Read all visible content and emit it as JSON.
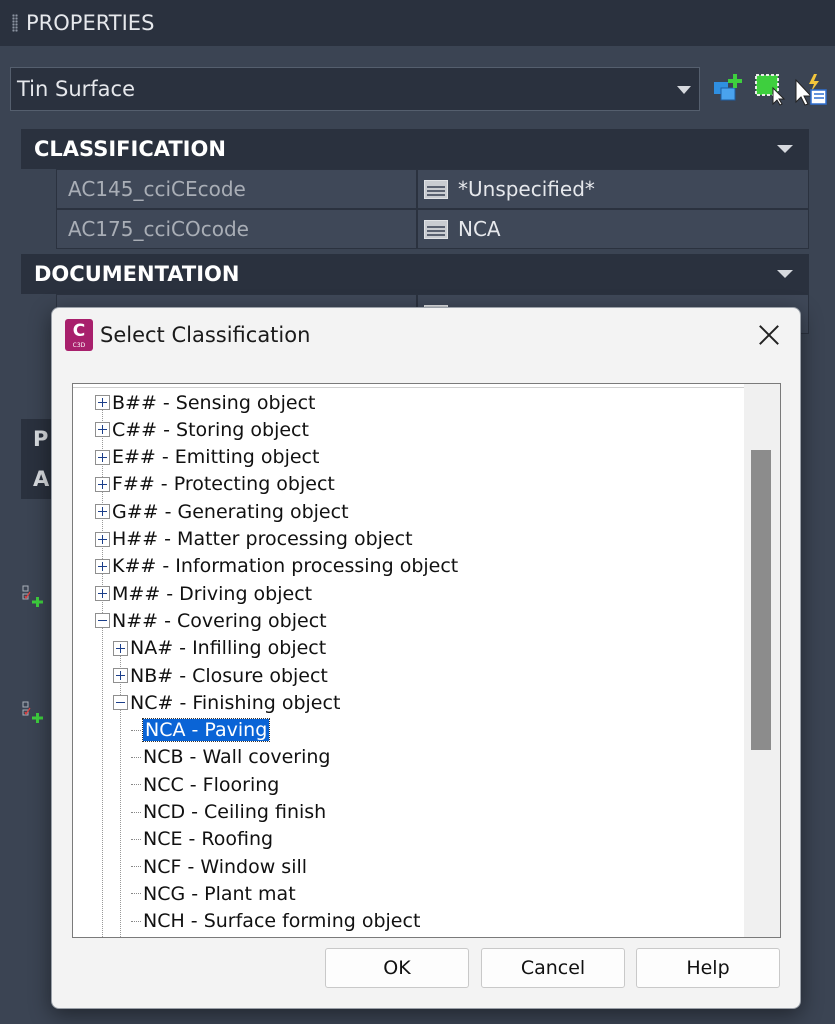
{
  "palette": {
    "title": "PROPERTIES",
    "object_type": "Tin Surface",
    "categories": [
      {
        "name": "CLASSIFICATION",
        "rows": [
          {
            "name": "AC145_cciCEcode",
            "value": "*Unspecified*"
          },
          {
            "name": "AC175_cciCOcode",
            "value": "NCA"
          }
        ]
      },
      {
        "name": "DOCUMENTATION"
      }
    ],
    "stub_1": "P",
    "stub_2": "A"
  },
  "dialog": {
    "title": "Select Classification",
    "app_icon_letter": "C",
    "app_icon_sub": "C3D",
    "tree": [
      {
        "label": "B## - Sensing object",
        "level": 0,
        "expander": "plus"
      },
      {
        "label": "C## - Storing object",
        "level": 0,
        "expander": "plus"
      },
      {
        "label": "E## - Emitting object",
        "level": 0,
        "expander": "plus"
      },
      {
        "label": "F## - Protecting object",
        "level": 0,
        "expander": "plus"
      },
      {
        "label": "G## - Generating object",
        "level": 0,
        "expander": "plus"
      },
      {
        "label": "H## - Matter processing object",
        "level": 0,
        "expander": "plus"
      },
      {
        "label": "K## - Information processing object",
        "level": 0,
        "expander": "plus"
      },
      {
        "label": "M## - Driving object",
        "level": 0,
        "expander": "plus"
      },
      {
        "label": "N## - Covering object",
        "level": 0,
        "expander": "minus"
      },
      {
        "label": "NA# - Infilling object",
        "level": 1,
        "expander": "plus"
      },
      {
        "label": "NB# - Closure object",
        "level": 1,
        "expander": "plus"
      },
      {
        "label": "NC# - Finishing object",
        "level": 1,
        "expander": "minus"
      },
      {
        "label": "NCA - Paving",
        "level": 2,
        "expander": "none",
        "selected": true
      },
      {
        "label": "NCB - Wall covering",
        "level": 2,
        "expander": "none"
      },
      {
        "label": "NCC - Flooring",
        "level": 2,
        "expander": "none"
      },
      {
        "label": "NCD - Ceiling finish",
        "level": 2,
        "expander": "none"
      },
      {
        "label": "NCE - Roofing",
        "level": 2,
        "expander": "none"
      },
      {
        "label": "NCF - Window sill",
        "level": 2,
        "expander": "none"
      },
      {
        "label": "NCG - Plant mat",
        "level": 2,
        "expander": "none"
      },
      {
        "label": "NCH - Surface forming object",
        "level": 2,
        "expander": "none"
      }
    ],
    "buttons": {
      "ok": "OK",
      "cancel": "Cancel",
      "help": "Help"
    }
  },
  "colors": {
    "palette_bg": "#3b4453",
    "header_bg": "#2a313e",
    "selection": "#0a64d6",
    "app_icon": "#a8206c"
  },
  "icons": [
    "quick-select-icon",
    "select-objects-icon",
    "toggle-pickadd-icon",
    "table-icon",
    "close-icon",
    "expand-icon",
    "collapse-icon"
  ]
}
